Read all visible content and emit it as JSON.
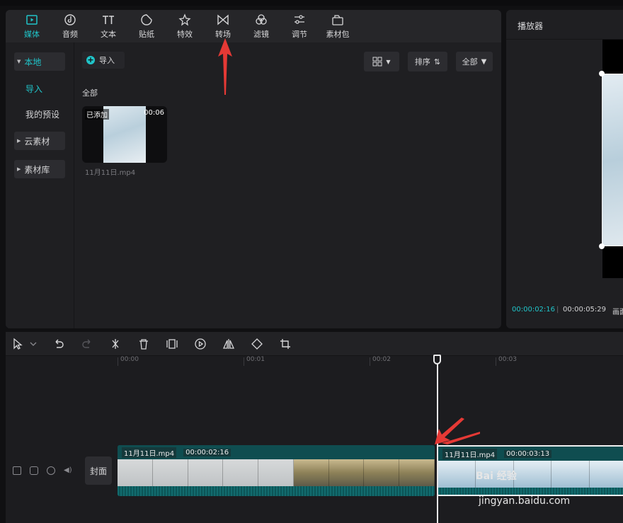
{
  "toolbar": {
    "items": [
      {
        "label": "媒体",
        "icon": "media-icon",
        "active": true
      },
      {
        "label": "音频",
        "icon": "audio-icon"
      },
      {
        "label": "文本",
        "icon": "text-icon"
      },
      {
        "label": "贴纸",
        "icon": "sticker-icon"
      },
      {
        "label": "特效",
        "icon": "effects-icon"
      },
      {
        "label": "转场",
        "icon": "transition-icon"
      },
      {
        "label": "滤镜",
        "icon": "filter-icon"
      },
      {
        "label": "调节",
        "icon": "adjust-icon"
      },
      {
        "label": "素材包",
        "icon": "material-pack-icon"
      }
    ],
    "accent": "#20c4c9"
  },
  "sidebar": {
    "local": "本地",
    "import": "导入",
    "presets": "我的预设",
    "cloud": "云素材",
    "library": "素材库"
  },
  "content": {
    "import_label": "导入",
    "sort_label": "排序",
    "all_label": "全部",
    "section_label": "全部",
    "clip": {
      "badge": "已添加",
      "duration": "00:06",
      "name": "11月11日.mp4"
    }
  },
  "player": {
    "title": "播放器",
    "current_time": "00:00:02:16",
    "total_time": "00:00:05:29",
    "extra": "画面"
  },
  "timeline": {
    "ticks": [
      "00:00",
      "00:01",
      "00:02",
      "00:03"
    ],
    "cover_label": "封面",
    "clips": [
      {
        "name": "11月11日.mp4",
        "duration": "00:00:02:16"
      },
      {
        "name": "11月11日.mp4",
        "duration": "00:00:03:13"
      }
    ]
  },
  "watermark": {
    "brand": "Bai 经验",
    "url": "jingyan.baidu.com"
  }
}
